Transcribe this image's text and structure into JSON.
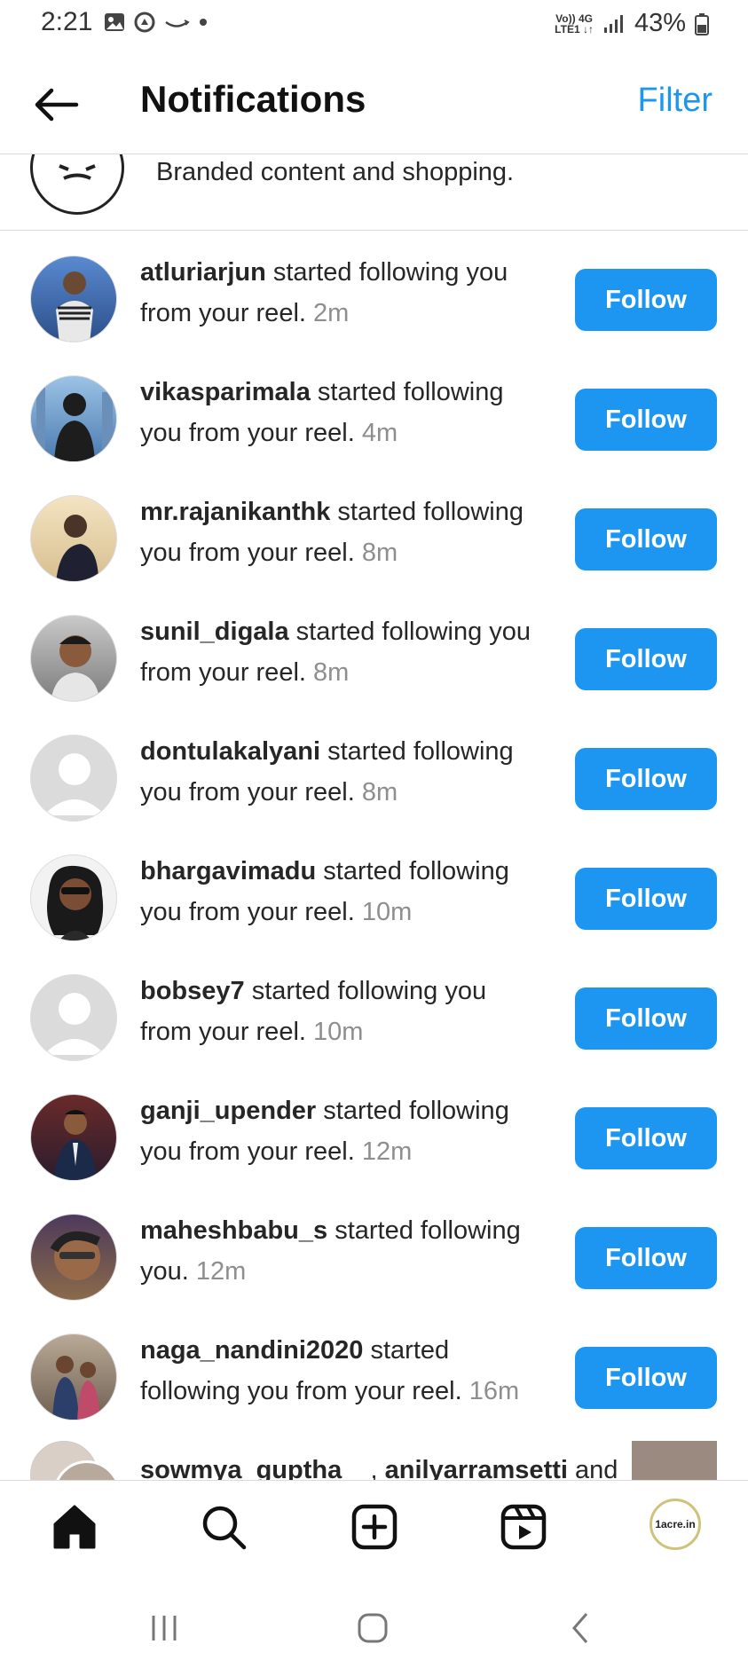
{
  "status_bar": {
    "time": "2:21",
    "network_top": "Vo)) 4G",
    "network_bottom": "LTE1 ↓↑",
    "battery": "43%"
  },
  "header": {
    "title": "Notifications",
    "filter_label": "Filter"
  },
  "branded": {
    "text": "Branded content and shopping."
  },
  "notifications": [
    {
      "username": "atluriarjun",
      "line1_rest": " started following you",
      "line2": "from your reel.",
      "ago": "2m",
      "button": "Follow"
    },
    {
      "username": "vikasparimala",
      "line1_rest": " started following",
      "line2": "you from your reel.",
      "ago": "4m",
      "button": "Follow"
    },
    {
      "username": "mr.rajanikanthk",
      "line1_rest": " started following",
      "line2": "you from your reel.",
      "ago": "8m",
      "button": "Follow"
    },
    {
      "username": "sunil_digala",
      "line1_rest": " started following you",
      "line2": "from your reel.",
      "ago": "8m",
      "button": "Follow"
    },
    {
      "username": "dontulakalyani",
      "line1_rest": " started following",
      "line2": "you from your reel.",
      "ago": "8m",
      "button": "Follow"
    },
    {
      "username": "bhargavimadu",
      "line1_rest": " started following",
      "line2": "you from your reel.",
      "ago": "10m",
      "button": "Follow"
    },
    {
      "username": "bobsey7",
      "line1_rest": " started following you",
      "line2": "from your reel.",
      "ago": "10m",
      "button": "Follow"
    },
    {
      "username": "ganji_upender",
      "line1_rest": " started following",
      "line2": "you from your reel.",
      "ago": "12m",
      "button": "Follow"
    },
    {
      "username": "maheshbabu_s",
      "line1_rest": " started following",
      "line2": "you.",
      "ago": "12m",
      "button": "Follow"
    },
    {
      "username": "naga_nandini2020",
      "line1_rest": " started",
      "line2": "following you from your reel.",
      "ago": "16m",
      "button": "Follow"
    }
  ],
  "partial_notification": {
    "user1": "sowmya_guptha__",
    "separator": ", ",
    "user2": "anilyarramsetti",
    "rest": " and"
  },
  "bottom_nav": {
    "profile_label": "1acre.in"
  }
}
